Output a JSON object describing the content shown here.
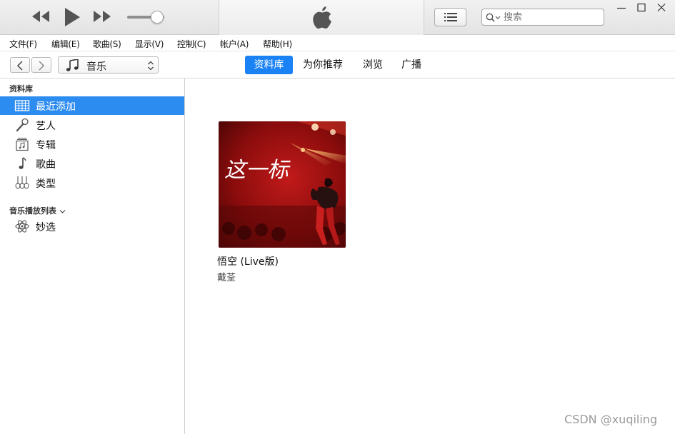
{
  "search": {
    "placeholder": "搜索"
  },
  "menu": [
    {
      "label": "文件(F)"
    },
    {
      "label": "编辑(E)"
    },
    {
      "label": "歌曲(S)"
    },
    {
      "label": "显示(V)"
    },
    {
      "label": "控制(C)"
    },
    {
      "label": "帐户(A)"
    },
    {
      "label": "帮助(H)"
    }
  ],
  "media_selector": {
    "label": "音乐"
  },
  "tabs": [
    {
      "label": "资料库",
      "active": true
    },
    {
      "label": "为你推荐",
      "active": false
    },
    {
      "label": "浏览",
      "active": false
    },
    {
      "label": "广播",
      "active": false
    }
  ],
  "sidebar": {
    "library_heading": "资料库",
    "library_items": [
      {
        "label": "最近添加",
        "icon": "grid-icon",
        "selected": true
      },
      {
        "label": "艺人",
        "icon": "microphone-icon",
        "selected": false
      },
      {
        "label": "专辑",
        "icon": "album-icon",
        "selected": false
      },
      {
        "label": "歌曲",
        "icon": "music-note-icon",
        "selected": false
      },
      {
        "label": "类型",
        "icon": "guitars-icon",
        "selected": false
      }
    ],
    "playlists_heading": "音乐播放列表",
    "playlist_items": [
      {
        "label": "妙选",
        "icon": "atom-icon"
      }
    ]
  },
  "album": {
    "title": "悟空 (Live版)",
    "artist": "戴荃",
    "cover_text": "这一标"
  },
  "player": {
    "volume_percent": 80
  },
  "watermark": "CSDN @xuqiling",
  "colors": {
    "accent": "#1a82f5",
    "selection": "#2d8cf0"
  }
}
